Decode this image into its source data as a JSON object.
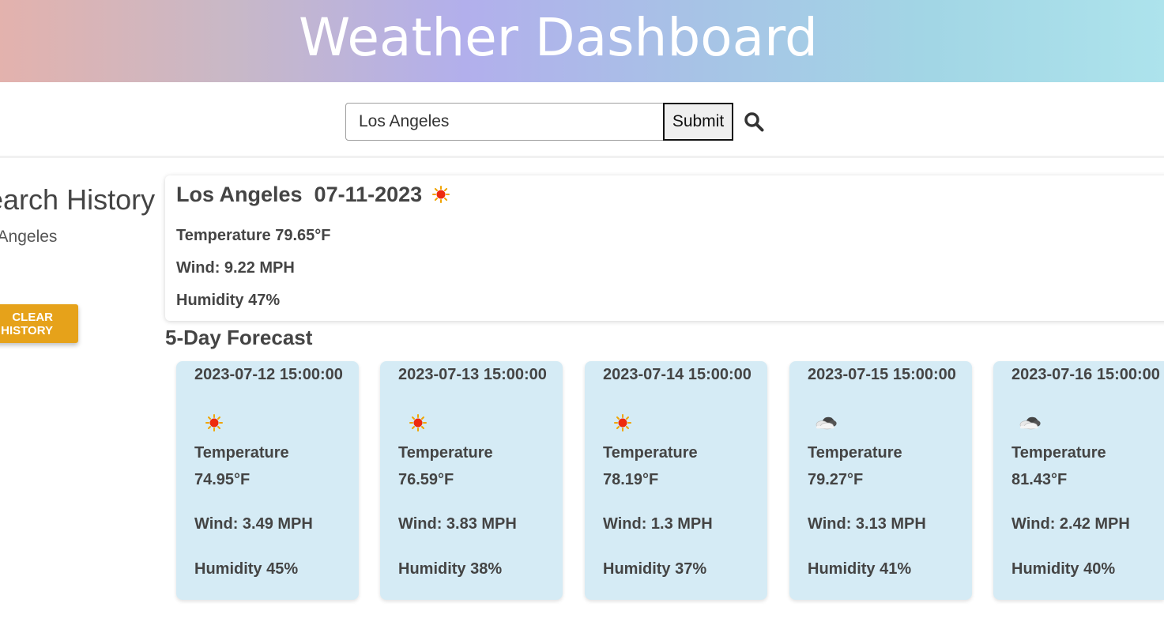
{
  "header": {
    "title": "Weather Dashboard"
  },
  "search": {
    "value": "Los Angeles",
    "submit_label": "Submit",
    "icon": "search-icon"
  },
  "sidebar": {
    "title": "Search History",
    "history": [
      "Los Angeles"
    ],
    "clear_label": "CLEAR HISTORY"
  },
  "current": {
    "city": "Los Angeles",
    "date": "07-11-2023",
    "icon": "sun-icon",
    "temperature": "Temperature 79.65°F",
    "wind": "Wind: 9.22 MPH",
    "humidity": "Humidity 47%"
  },
  "forecast": {
    "title": "5-Day Forecast",
    "temp_label": "Temperature",
    "days": [
      {
        "date": "2023-07-12 15:00:00",
        "icon": "sun-icon",
        "temp": "74.95°F",
        "wind": "Wind: 3.49 MPH",
        "humidity": "Humidity 45%"
      },
      {
        "date": "2023-07-13 15:00:00",
        "icon": "sun-icon",
        "temp": "76.59°F",
        "wind": "Wind: 3.83 MPH",
        "humidity": "Humidity 38%"
      },
      {
        "date": "2023-07-14 15:00:00",
        "icon": "sun-icon",
        "temp": "78.19°F",
        "wind": "Wind: 1.3 MPH",
        "humidity": "Humidity 37%"
      },
      {
        "date": "2023-07-15 15:00:00",
        "icon": "cloud-icon",
        "temp": "79.27°F",
        "wind": "Wind: 3.13 MPH",
        "humidity": "Humidity 41%"
      },
      {
        "date": "2023-07-16 15:00:00",
        "icon": "cloud-icon",
        "temp": "81.43°F",
        "wind": "Wind: 2.42 MPH",
        "humidity": "Humidity 40%"
      }
    ]
  },
  "colors": {
    "clear_button": "#e6a21a",
    "forecast_card": "#d5ebf5",
    "sun": "#ee2a0e"
  }
}
